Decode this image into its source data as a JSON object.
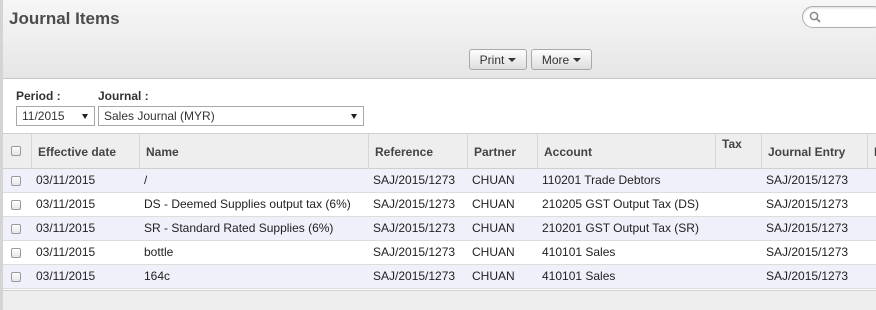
{
  "page": {
    "title": "Journal Items"
  },
  "search": {
    "placeholder": ""
  },
  "toolbar": {
    "print_label": "Print",
    "more_label": "More"
  },
  "filters": {
    "period_label": "Period :",
    "period_value": "11/2015",
    "journal_label": "Journal :",
    "journal_value": "Sales Journal (MYR)"
  },
  "table": {
    "columns": [
      "Effective date",
      "Name",
      "Reference",
      "Partner",
      "Account",
      "Tax",
      "Journal Entry",
      "D"
    ],
    "rows": [
      {
        "date": "03/11/2015",
        "name": "/",
        "reference": "SAJ/2015/1273",
        "partner": "CHUAN",
        "account": "110201 Trade Debtors",
        "tax": "",
        "journal_entry": "SAJ/2015/1273"
      },
      {
        "date": "03/11/2015",
        "name": "DS - Deemed Supplies output tax (6%)",
        "reference": "SAJ/2015/1273",
        "partner": "CHUAN",
        "account": "210205 GST Output Tax (DS)",
        "tax": "",
        "journal_entry": "SAJ/2015/1273"
      },
      {
        "date": "03/11/2015",
        "name": "SR - Standard Rated Supplies (6%)",
        "reference": "SAJ/2015/1273",
        "partner": "CHUAN",
        "account": "210201 GST Output Tax (SR)",
        "tax": "",
        "journal_entry": "SAJ/2015/1273"
      },
      {
        "date": "03/11/2015",
        "name": "bottle",
        "reference": "SAJ/2015/1273",
        "partner": "CHUAN",
        "account": "410101 Sales",
        "tax": "",
        "journal_entry": "SAJ/2015/1273"
      },
      {
        "date": "03/11/2015",
        "name": "164c",
        "reference": "SAJ/2015/1273",
        "partner": "CHUAN",
        "account": "410101 Sales",
        "tax": "",
        "journal_entry": "SAJ/2015/1273"
      }
    ]
  },
  "icons": {
    "search": "search-icon",
    "dropdown": "caret-down-icon",
    "select": "checkbox-icon"
  },
  "colors": {
    "row_alt": "#f0f0fa",
    "header_bg": "#eeeeee"
  }
}
